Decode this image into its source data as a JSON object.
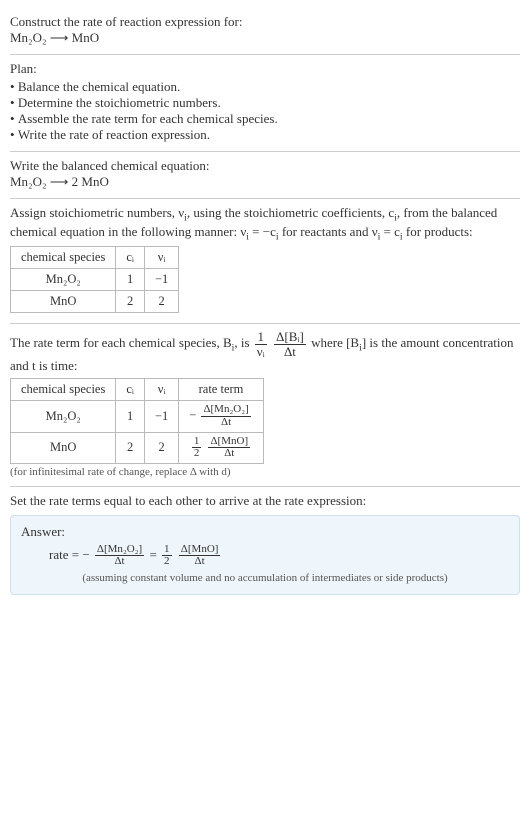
{
  "header": {
    "construct_line": "Construct the rate of reaction expression for:",
    "unbalanced_eq": "Mn₂O₂ ⟶ MnO"
  },
  "plan": {
    "title": "Plan:",
    "items": [
      "Balance the chemical equation.",
      "Determine the stoichiometric numbers.",
      "Assemble the rate term for each chemical species.",
      "Write the rate of reaction expression."
    ]
  },
  "balanced": {
    "title": "Write the balanced chemical equation:",
    "eq": "Mn₂O₂ ⟶ 2 MnO"
  },
  "assign": {
    "text_before": "Assign stoichiometric numbers, ν",
    "text_before2": ", using the stoichiometric coefficients, c",
    "text_before3": ", from the balanced chemical equation in the following manner: ν",
    "text_before4": " = −c",
    "text_before5": " for reactants and ν",
    "text_before6": " = c",
    "text_before7": " for products:",
    "table": {
      "h1": "chemical species",
      "h2": "cᵢ",
      "h3": "νᵢ",
      "rows": [
        {
          "sp": "Mn₂O₂",
          "c": "1",
          "v": "−1"
        },
        {
          "sp": "MnO",
          "c": "2",
          "v": "2"
        }
      ]
    }
  },
  "rate_term": {
    "text1": "The rate term for each chemical species, B",
    "text2": ", is ",
    "frac1_num": "1",
    "frac1_den": "νᵢ",
    "frac2_num": "Δ[Bᵢ]",
    "frac2_den": "Δt",
    "text3": " where [B",
    "text4": "] is the amount concentration and t is time:",
    "table": {
      "h1": "chemical species",
      "h2": "cᵢ",
      "h3": "νᵢ",
      "h4": "rate term",
      "rows": [
        {
          "sp": "Mn₂O₂",
          "c": "1",
          "v": "−1",
          "neg": "−",
          "num": "Δ[Mn₂O₂]",
          "den": "Δt",
          "coef_num": "",
          "coef_den": ""
        },
        {
          "sp": "MnO",
          "c": "2",
          "v": "2",
          "neg": "",
          "coef_num": "1",
          "coef_den": "2",
          "num": "Δ[MnO]",
          "den": "Δt"
        }
      ]
    },
    "note": "(for infinitesimal rate of change, replace Δ with d)"
  },
  "set_equal": {
    "text": "Set the rate terms equal to each other to arrive at the rate expression:"
  },
  "answer": {
    "label": "Answer:",
    "rate_eq_prefix": "rate = −",
    "f1_num": "Δ[Mn₂O₂]",
    "f1_den": "Δt",
    "eq": " = ",
    "half_num": "1",
    "half_den": "2",
    "f2_num": "Δ[MnO]",
    "f2_den": "Δt",
    "assumption": "(assuming constant volume and no accumulation of intermediates or side products)"
  },
  "chart_data": {
    "type": "table",
    "tables": [
      {
        "title": "stoichiometric numbers",
        "columns": [
          "chemical species",
          "c_i",
          "ν_i"
        ],
        "rows": [
          [
            "Mn2O2",
            1,
            -1
          ],
          [
            "MnO",
            2,
            2
          ]
        ]
      },
      {
        "title": "rate terms",
        "columns": [
          "chemical species",
          "c_i",
          "ν_i",
          "rate term"
        ],
        "rows": [
          [
            "Mn2O2",
            1,
            -1,
            "-Δ[Mn2O2]/Δt"
          ],
          [
            "MnO",
            2,
            2,
            "(1/2) Δ[MnO]/Δt"
          ]
        ]
      }
    ],
    "rate_expression": "rate = -Δ[Mn2O2]/Δt = (1/2) Δ[MnO]/Δt"
  }
}
